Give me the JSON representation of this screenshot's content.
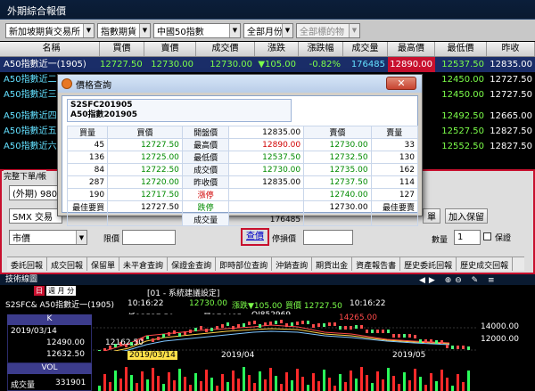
{
  "window": {
    "title": "外期綜合報價"
  },
  "filters": [
    {
      "label": "新加坡期貨交易所"
    },
    {
      "label": "指數期貨"
    },
    {
      "label": "中國50指數"
    },
    {
      "label": "全部月份"
    },
    {
      "label": "全部標的物",
      "disabled": true
    }
  ],
  "grid": {
    "columns": [
      "名稱",
      "買價",
      "賣價",
      "成交價",
      "漲跌",
      "漲跌幅",
      "成交量",
      "最高價",
      "最低價",
      "昨收"
    ],
    "rows": [
      {
        "name": "A50指數近一(1905)",
        "bid": "12727.50",
        "ask": "12730.00",
        "last": "12730.00",
        "chg": "▼105.00",
        "pct": "-0.82%",
        "vol": "176485",
        "high": "12890.00",
        "low": "12537.50",
        "prev": "12835.00",
        "selected": true
      },
      {
        "name": "A50指數近二",
        "low": "12450.00",
        "prev": "12727.50"
      },
      {
        "name": "A50指數近三",
        "low": "12450.00",
        "prev": "12727.50"
      },
      {
        "name": "A50指數近四",
        "low": "12492.50",
        "prev": "12665.00"
      },
      {
        "name": "A50指數近五",
        "low": "12527.50",
        "prev": "12827.50"
      },
      {
        "name": "A50指數近六",
        "low": "12552.50",
        "prev": "12827.50"
      }
    ]
  },
  "popup": {
    "title": "價格查詢",
    "close_label": "✕",
    "code": "S2SFC201905",
    "name": "A50指數201905",
    "headers": [
      "買量",
      "買價",
      "開盤價",
      "12835.00",
      "賣價",
      "賣量"
    ],
    "rows": [
      [
        "45",
        "12727.50",
        "最高價",
        "12890.00",
        "12730.00",
        "33"
      ],
      [
        "136",
        "12725.00",
        "最低價",
        "12537.50",
        "12732.50",
        "130"
      ],
      [
        "84",
        "12722.50",
        "成交價",
        "12730.00",
        "12735.00",
        "162"
      ],
      [
        "287",
        "12720.00",
        "昨收價",
        "12835.00",
        "12737.50",
        "114"
      ],
      [
        "190",
        "12717.50",
        "漲停",
        "",
        "12740.00",
        "127"
      ],
      [
        "最佳要買",
        "12727.50",
        "跌停",
        "",
        "12730.00",
        "最佳要賣"
      ],
      [
        "",
        "",
        "成交量",
        "176485",
        "",
        ""
      ]
    ]
  },
  "order_panel": {
    "title": "完整下單/帳",
    "market_label": "(外期) 980",
    "product_label": "SMX 交易",
    "price_type": "市價",
    "limit_label": "限價",
    "query_label": "查價",
    "stop_label": "停損價",
    "qty_label": "數量",
    "qty_value": "1",
    "stop_checkbox_label": "保證",
    "add_label": "加入保留",
    "mid_label": "單"
  },
  "tabs": [
    "委託回報",
    "成交回報",
    "保留單",
    "未平倉查詢",
    "保證金查詢",
    "即時部位查詢",
    "沖銷查詢",
    "期貨出金",
    "資產報告書",
    "歷史委託回報",
    "歷史成交回報"
  ],
  "tech": {
    "title": "技術線圖",
    "period": "日",
    "month_option": "週 月 分",
    "symbol": "S2SFC& A50指數近一(1905)",
    "section": "[01 - 系統建議設定]",
    "time": "10:16:22",
    "last": "12730.00",
    "chg": "漲跌▼105.00",
    "bid_label": "買價 12727.50",
    "time2": "10:16:22",
    "low_label": "低12537.50",
    "vol_label": "量176485",
    "oi_label": "OI852969",
    "k_label": "K",
    "k_date": "2019/03/14",
    "k_price": "12490.00",
    "k_price2": "12632.50",
    "peak": "14265.00",
    "trough": "12162.50",
    "axis_14000": "14000.00",
    "axis_12000": "12000.00",
    "date1": "2019/03/14",
    "date2": "2019/04",
    "date3": "2019/05",
    "vol_tab": "VOL",
    "vol_side": "成交量",
    "vol_value": "331901"
  }
}
